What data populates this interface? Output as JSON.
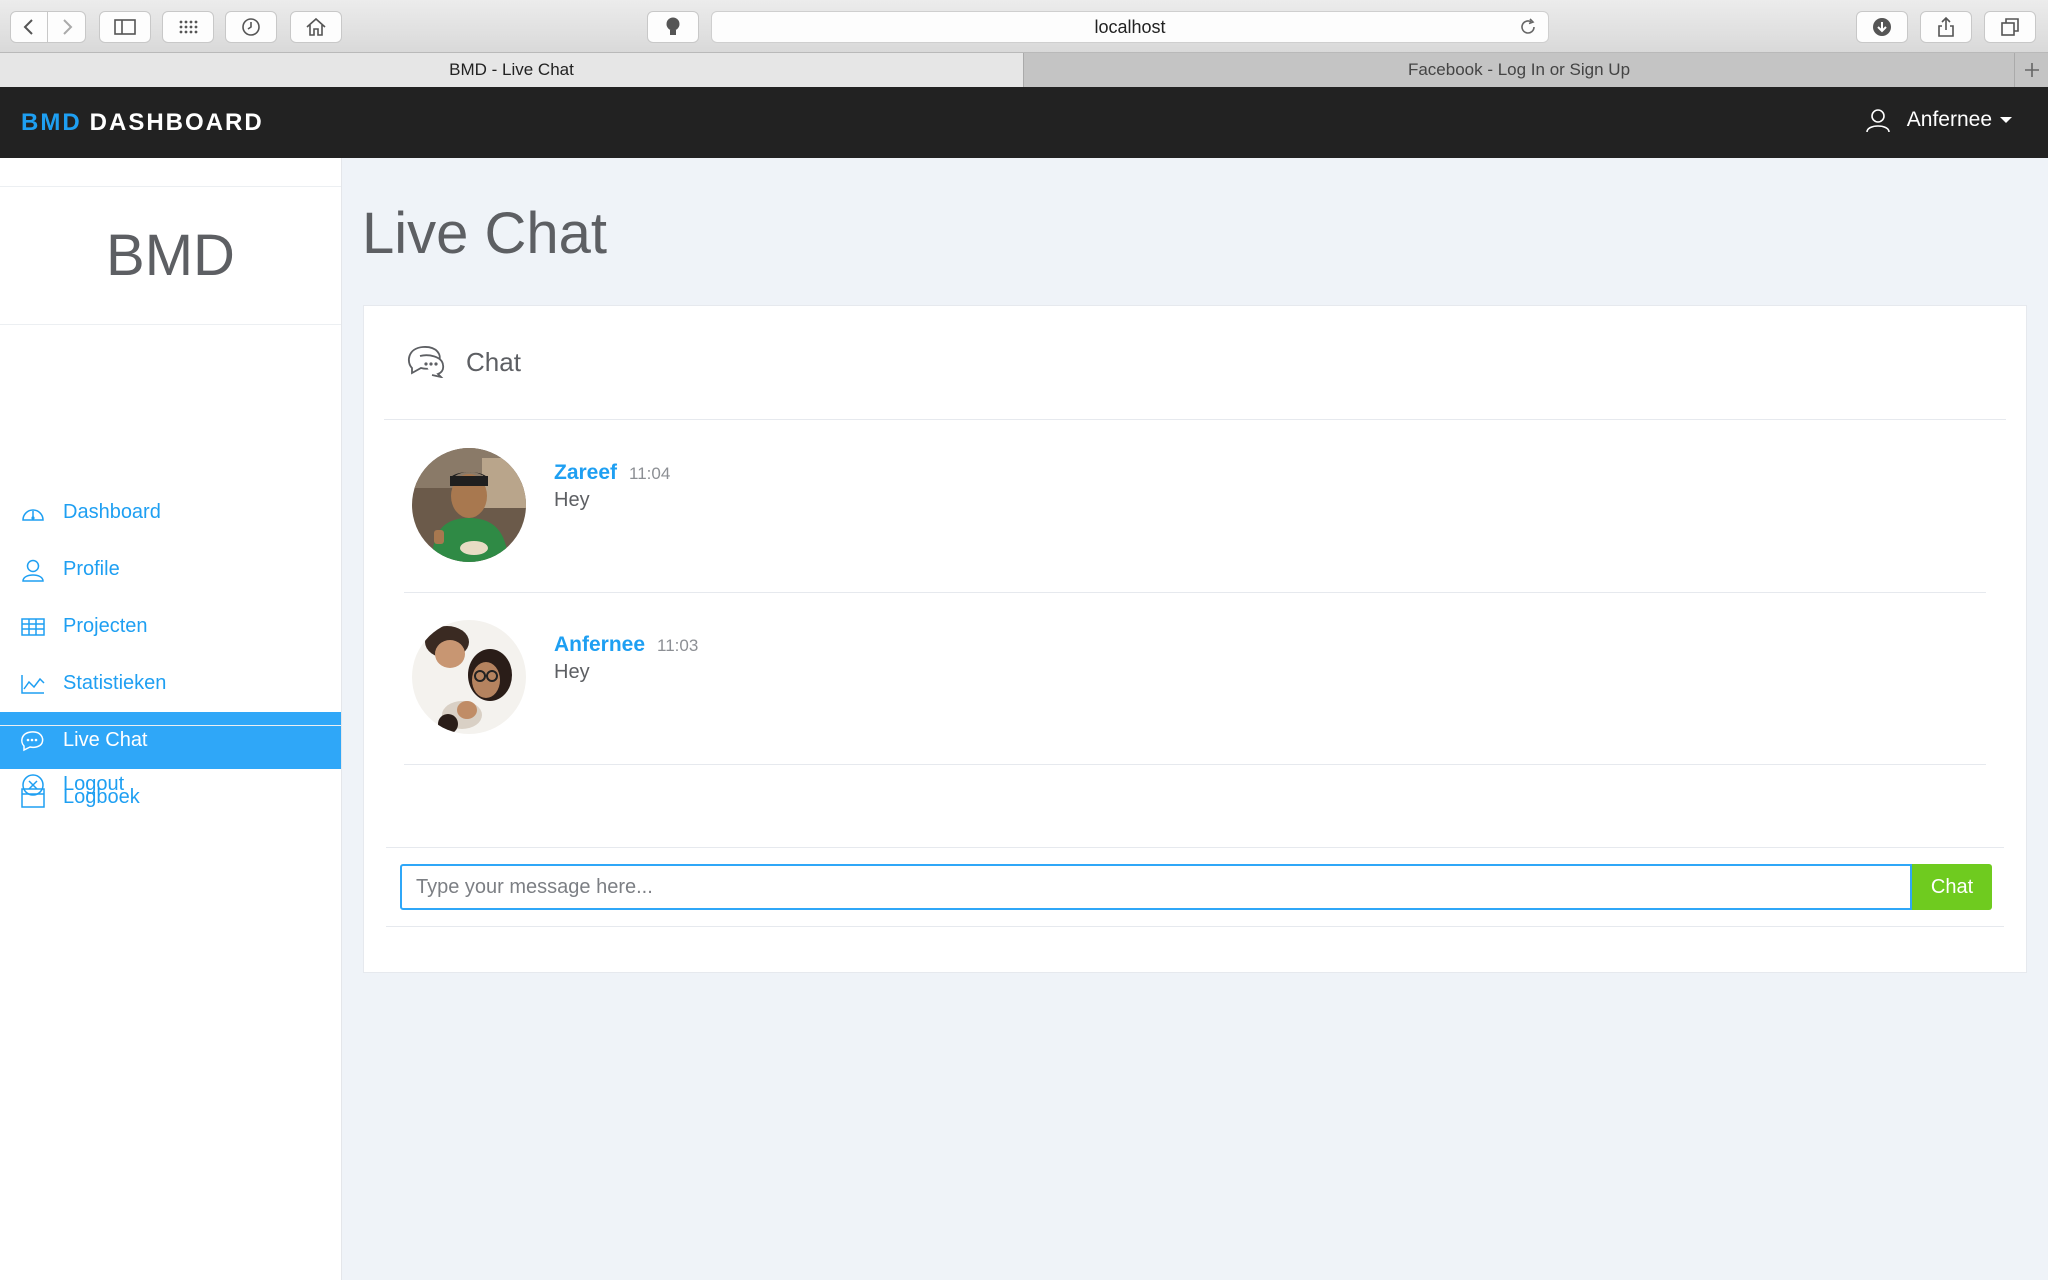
{
  "browser": {
    "url": "localhost",
    "tabs": [
      {
        "label": "BMD - Live Chat",
        "active": true
      },
      {
        "label": "Facebook - Log In or Sign Up",
        "active": false
      }
    ]
  },
  "header": {
    "brand_accent": "BMD",
    "brand_rest": "DASHBOARD",
    "user_name": "Anfernee"
  },
  "sidebar": {
    "logo": "BMD",
    "items": [
      {
        "label": "Dashboard",
        "icon": "speedometer-icon",
        "active": false
      },
      {
        "label": "Profile",
        "icon": "user-icon",
        "active": false
      },
      {
        "label": "Projecten",
        "icon": "table-icon",
        "active": false
      },
      {
        "label": "Statistieken",
        "icon": "line-chart-icon",
        "active": false
      },
      {
        "label": "Live Chat",
        "icon": "chat-icon",
        "active": true
      },
      {
        "label": "Logboek",
        "icon": "window-icon",
        "active": false
      }
    ],
    "logout_label": "Logout"
  },
  "main": {
    "title": "Live Chat",
    "card_title": "Chat",
    "messages": [
      {
        "author": "Zareef",
        "time": "11:04",
        "text": "Hey"
      },
      {
        "author": "Anfernee",
        "time": "11:03",
        "text": "Hey"
      }
    ],
    "input_placeholder": "Type your message here...",
    "send_label": "Chat"
  },
  "colors": {
    "accent": "#1e9ff2",
    "active_nav": "#2fa7f8",
    "send_button": "#6fcb1f",
    "header_bg": "#222222",
    "page_bg": "#eff3f8"
  }
}
